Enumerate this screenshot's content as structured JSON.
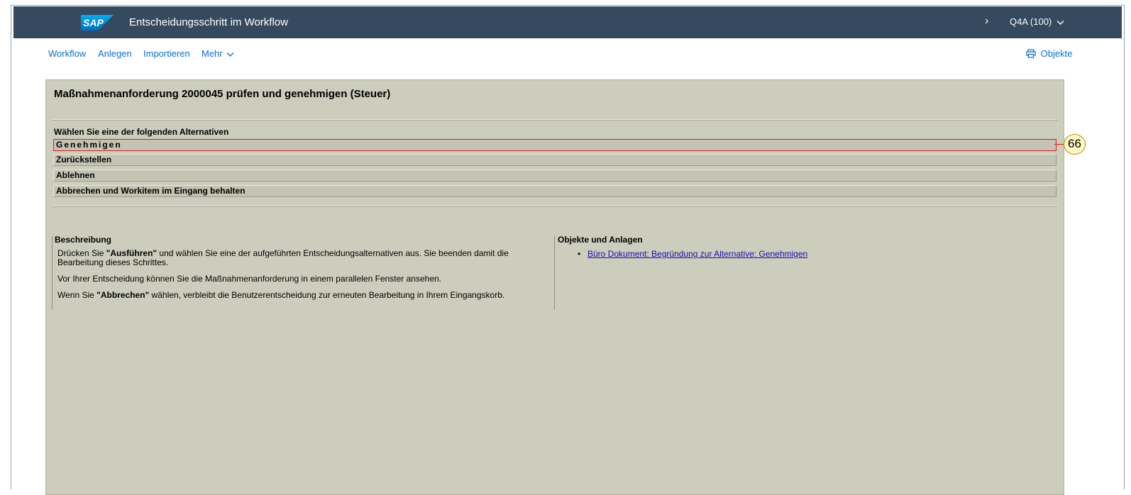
{
  "shell": {
    "logo_text": "SAP",
    "title": "Entscheidungsschritt im Workflow",
    "system": "Q4A (100)"
  },
  "toolbar": {
    "items": [
      "Workflow",
      "Anlegen",
      "Importieren",
      "Mehr"
    ],
    "objects_label": "Objekte"
  },
  "panel": {
    "title": "Maßnahmenanforderung 2000045 prüfen und genehmigen (Steuer)",
    "choose_label": "Wählen Sie eine der folgenden Alternativen",
    "alternatives": [
      "Genehmigen",
      "Zurückstellen",
      "Ablehnen",
      "Abbrechen und Workitem im Eingang behalten"
    ]
  },
  "description": {
    "heading": "Beschreibung",
    "p1_a": "Drücken Sie ",
    "p1_bold": "\"Ausführen\"",
    "p1_b": " und wählen Sie eine der aufgeführten Entscheidungsalternativen aus. Sie beenden damit die Bearbeitung dieses Schrittes.",
    "p2": "Vor Ihrer Entscheidung können Sie die Maßnahmenanforderung in einem parallelen Fenster ansehen.",
    "p3_a": "Wenn Sie ",
    "p3_bold": "\"Abbrechen\"",
    "p3_b": " wählen, verbleibt die Benutzerentscheidung zur erneuten Bearbeitung in Ihrem Eingangskorb."
  },
  "objects": {
    "heading": "Objekte und Anlagen",
    "link": "Büro Dokument: Begründung zur Alternative: Genehmigen"
  },
  "annotation": {
    "badge": "66"
  },
  "colors": {
    "shellbar": "#354a5f",
    "link": "#0a6ed1",
    "panel": "#cccdbc",
    "highlight": "#e11a1a"
  }
}
